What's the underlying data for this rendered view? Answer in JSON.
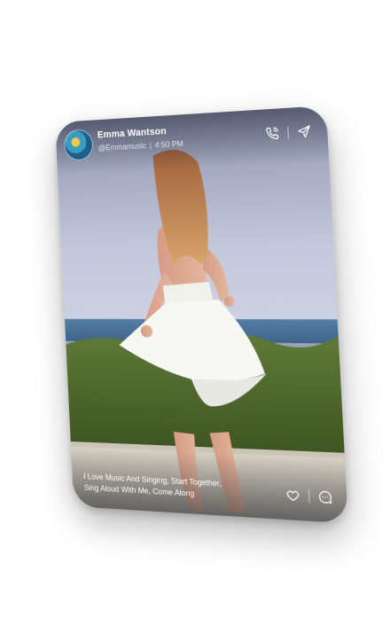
{
  "post": {
    "user_name": "Emma Wantson",
    "handle": "@Emmamusic",
    "time": "4:50 PM",
    "caption": "I Love Music And Singing, Start Together, Sing Aloud With Me, Come Along"
  },
  "icons": {
    "avatar": "profile-avatar",
    "call": "phone-icon",
    "share": "send-icon",
    "like": "heart-icon",
    "comment": "chat-bubble-icon"
  },
  "colors": {
    "text": "#ffffff",
    "sky": "#b9bfd6",
    "sea": "#4a6f96",
    "foliage": "#4e6a2c",
    "ground": "#d8d2c6",
    "dress": "#f7f7f4"
  }
}
